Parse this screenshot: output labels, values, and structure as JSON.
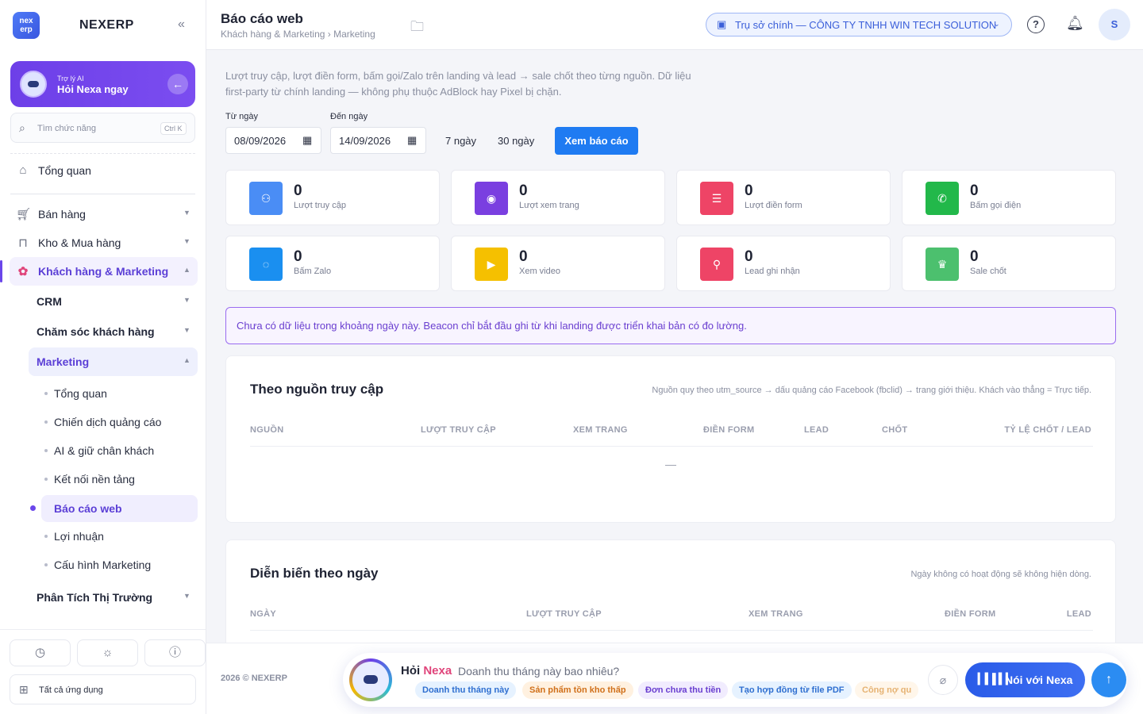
{
  "app": {
    "logo_mark": "nex erp",
    "name": "NEXERP"
  },
  "ai_card": {
    "small": "Trợ lý AI",
    "big": "Hỏi Nexa ngay"
  },
  "search": {
    "placeholder": "Tìm chức năng",
    "shortcut": "Ctrl K"
  },
  "nav": {
    "overview": "Tổng quan",
    "sales": "Bán hàng",
    "warehouse": "Kho & Mua hàng",
    "crm_marketing": "Khách hàng & Marketing",
    "sub_crm": "CRM",
    "sub_care": "Chăm sóc khách hàng",
    "sub_marketing": "Marketing",
    "leaves": [
      "Tổng quan",
      "Chiến dịch quảng cáo",
      "AI & giữ chân khách",
      "Kết nối nền tảng",
      "Báo cáo web",
      "Lợi nhuận",
      "Cấu hình Marketing"
    ],
    "sub_market": "Phân Tích Thị Trường"
  },
  "sidebar_bottom": {
    "all_apps": "Tất cả ứng dụng"
  },
  "header": {
    "title": "Báo cáo web",
    "breadcrumb": "Khách hàng & Marketing › Marketing",
    "company": "Trụ sở chính — CÔNG TY TNHH WIN TECH SOLUTION",
    "avatar": "S"
  },
  "intro": "Lượt truy cập, lượt điền form, bấm gọi/Zalo trên landing và lead → sale chốt theo từng nguồn. Dữ liệu first-party từ chính landing — không phụ thuộc AdBlock hay Pixel bị chặn.",
  "filters": {
    "from_label": "Từ ngày",
    "from_value": "08/09/2026",
    "to_label": "Đến ngày",
    "to_value": "14/09/2026",
    "q7": "7 ngày",
    "q30": "30 ngày",
    "submit": "Xem báo cáo"
  },
  "stats": [
    {
      "value": "0",
      "label": "Lượt truy cập",
      "color": "#4a8df5"
    },
    {
      "value": "0",
      "label": "Lượt xem trang",
      "color": "#7a3fe0"
    },
    {
      "value": "0",
      "label": "Lượt điền form",
      "color": "#ee4466"
    },
    {
      "value": "0",
      "label": "Bấm gọi điện",
      "color": "#22b84a"
    },
    {
      "value": "0",
      "label": "Bấm Zalo",
      "color": "#1a8ff0"
    },
    {
      "value": "0",
      "label": "Xem video",
      "color": "#f5c000"
    },
    {
      "value": "0",
      "label": "Lead ghi nhận",
      "color": "#ee4466"
    },
    {
      "value": "0",
      "label": "Sale chốt",
      "color": "#4cc06e"
    }
  ],
  "alert": "Chưa có dữ liệu trong khoảng ngày này. Beacon chỉ bắt đầu ghi từ khi landing được triển khai bản có đo lường.",
  "by_source": {
    "title": "Theo nguồn truy cập",
    "note": "Nguồn quy theo utm_source → dấu quảng cáo Facebook (fbclid) → trang giới thiệu. Khách vào thẳng = Trực tiếp.",
    "columns": [
      "NGUỒN",
      "LƯỢT TRUY CẬP",
      "XEM TRANG",
      "ĐIỀN FORM",
      "LEAD",
      "CHỐT",
      "TỶ LỆ CHỐT / LEAD"
    ],
    "empty": "—"
  },
  "by_day": {
    "title": "Diễn biến theo ngày",
    "note": "Ngày không có hoạt động sẽ không hiện dòng.",
    "columns": [
      "NGÀY",
      "LƯỢT TRUY CẬP",
      "XEM TRANG",
      "ĐIỀN FORM",
      "LEAD"
    ]
  },
  "footer": {
    "copyright": "2026 © NEXERP"
  },
  "chat": {
    "hoi": "Hỏi",
    "nexa": "Nexa",
    "question": "Doanh thu tháng này bao nhiêu?",
    "chips": [
      "Doanh thu tháng này",
      "Sản phẩm tồn kho thấp",
      "Đơn chưa thu tiền",
      "Tạo hợp đồng từ file PDF",
      "Công nợ qu"
    ],
    "talk": "Nói với Nexa"
  }
}
